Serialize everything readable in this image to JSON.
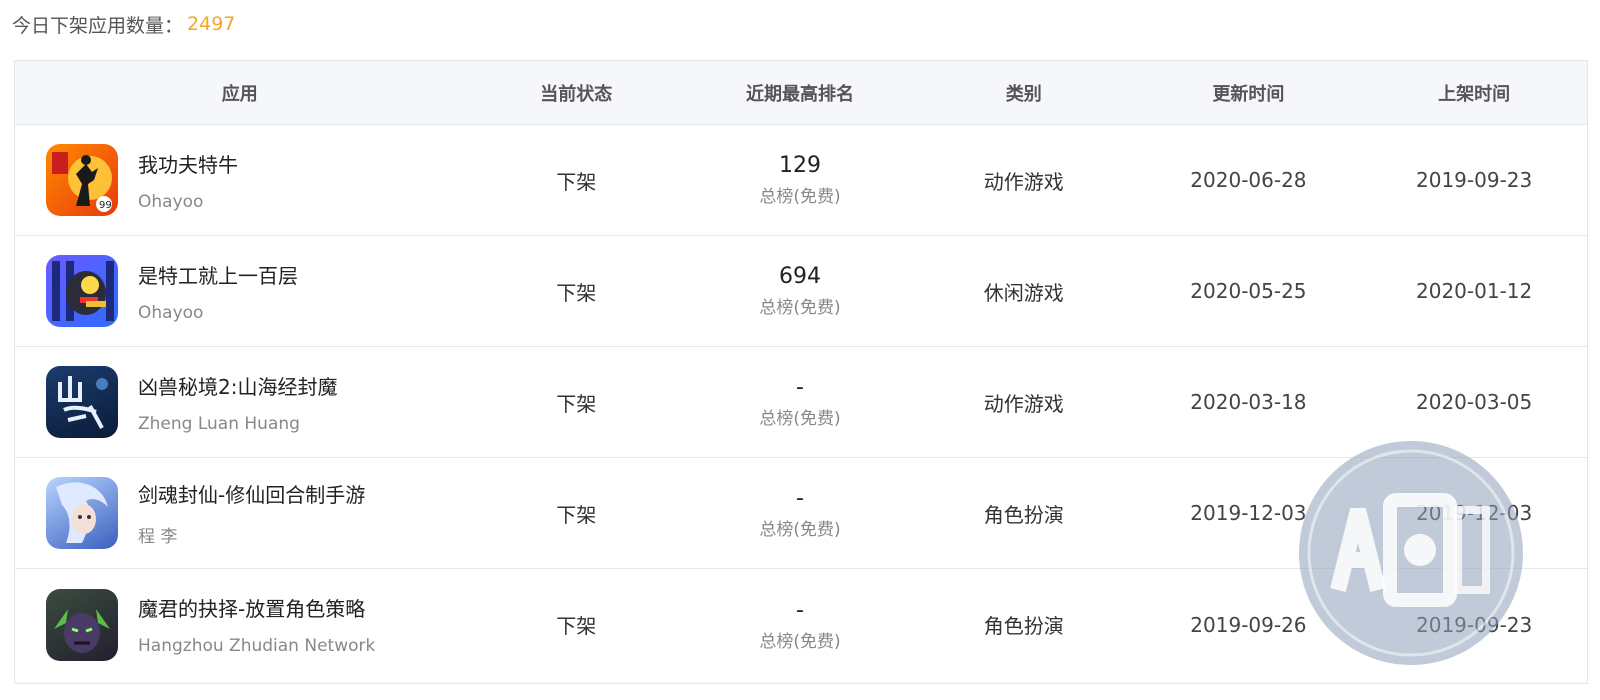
{
  "summary": {
    "label": "今日下架应用数量：",
    "count": "2497"
  },
  "columns": {
    "app": "应用",
    "status": "当前状态",
    "rank": "近期最高排名",
    "category": "类别",
    "updated": "更新时间",
    "listed": "上架时间"
  },
  "rows": [
    {
      "name": "我功夫特牛",
      "developer": "Ohayoo",
      "status": "下架",
      "rank": "129",
      "rank_board": "总榜(免费)",
      "category": "动作游戏",
      "updated": "2020-06-28",
      "listed": "2019-09-23"
    },
    {
      "name": "是特工就上一百层",
      "developer": "Ohayoo",
      "status": "下架",
      "rank": "694",
      "rank_board": "总榜(免费)",
      "category": "休闲游戏",
      "updated": "2020-05-25",
      "listed": "2020-01-12"
    },
    {
      "name": "凶兽秘境2:山海经封魔",
      "developer": "Zheng Luan Huang",
      "status": "下架",
      "rank": "-",
      "rank_board": "总榜(免费)",
      "category": "动作游戏",
      "updated": "2020-03-18",
      "listed": "2020-03-05"
    },
    {
      "name": "剑魂封仙-修仙回合制手游",
      "developer": "程 李",
      "status": "下架",
      "rank": "-",
      "rank_board": "总榜(免费)",
      "category": "角色扮演",
      "updated": "2019-12-03",
      "listed": "2019-12-03"
    },
    {
      "name": "魔君的抉择-放置角色策略",
      "developer": "Hangzhou Zhudian Network",
      "status": "下架",
      "rank": "-",
      "rank_board": "总榜(免费)",
      "category": "角色扮演",
      "updated": "2019-09-26",
      "listed": "2019-09-23"
    }
  ],
  "icons": [
    "kungfu-app-icon",
    "agent-app-icon",
    "shanhai-app-icon",
    "jianhun-app-icon",
    "mojun-app-icon"
  ],
  "colors": {
    "count": "#f5a623",
    "header_bg": "#f5f7fa",
    "border": "#e3e6ea"
  }
}
